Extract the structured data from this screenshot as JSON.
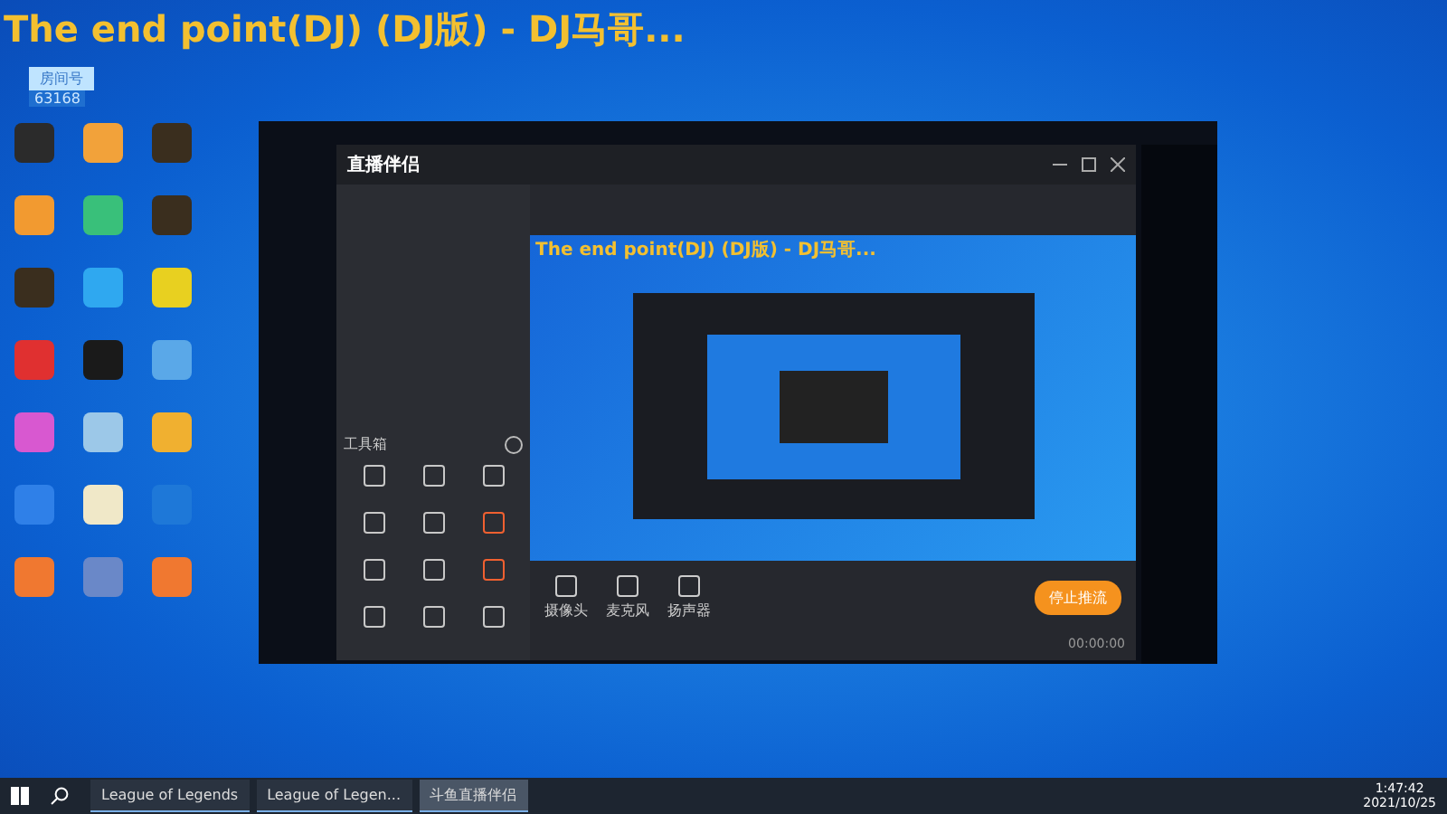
{
  "overlay_title": "The end point(DJ) (DJ版) - DJ马哥...",
  "room_badge": {
    "label": "房间号",
    "number": "63168"
  },
  "desktop_icons": [
    {
      "color": "#2b2b2b"
    },
    {
      "color": "#f2a23a"
    },
    {
      "color": "#3a2e1e"
    },
    {
      "color": "#f29a30"
    },
    {
      "color": "#39c07a"
    },
    {
      "color": "#3a2e1e"
    },
    {
      "color": "#3a2e1e"
    },
    {
      "color": "#2fa8f0"
    },
    {
      "color": "#e8d020"
    },
    {
      "color": "#e03030"
    },
    {
      "color": "#1a1a1a"
    },
    {
      "color": "#5aa8e8"
    },
    {
      "color": "#d858d0"
    },
    {
      "color": "#9cc8e8"
    },
    {
      "color": "#f0b030"
    },
    {
      "color": "#2f80e8"
    },
    {
      "color": "#f0e8c8"
    },
    {
      "color": "#1e78d8"
    },
    {
      "color": "#f07830"
    },
    {
      "color": "#6a88c8"
    },
    {
      "color": "#f07830"
    }
  ],
  "app": {
    "name": "直播伴侣",
    "preview_title": "The end point(DJ) (DJ版) - DJ马哥...",
    "toolbox_title": "工具箱",
    "tools": [
      {
        "color": "#c8c8c8"
      },
      {
        "color": "#c8c8c8"
      },
      {
        "color": "#c8c8c8"
      },
      {
        "color": "#c8c8c8"
      },
      {
        "color": "#c8c8c8"
      },
      {
        "color": "#f06030"
      },
      {
        "color": "#c8c8c8"
      },
      {
        "color": "#c8c8c8"
      },
      {
        "color": "#f06030"
      },
      {
        "color": "#c8c8c8"
      },
      {
        "color": "#c8c8c8"
      },
      {
        "color": "#c8c8c8"
      }
    ],
    "controls": [
      {
        "label": "摄像头"
      },
      {
        "label": "麦克风"
      },
      {
        "label": "扬声器"
      }
    ],
    "stop_button": "停止推流",
    "timer": "00:00:00"
  },
  "taskbar": {
    "items": [
      {
        "label": "League of Legends",
        "selected": false
      },
      {
        "label": "League of Legen...",
        "selected": false
      },
      {
        "label": "斗鱼直播伴侣",
        "selected": true
      }
    ],
    "time": "1:47:42",
    "date": "2021/10/25"
  }
}
